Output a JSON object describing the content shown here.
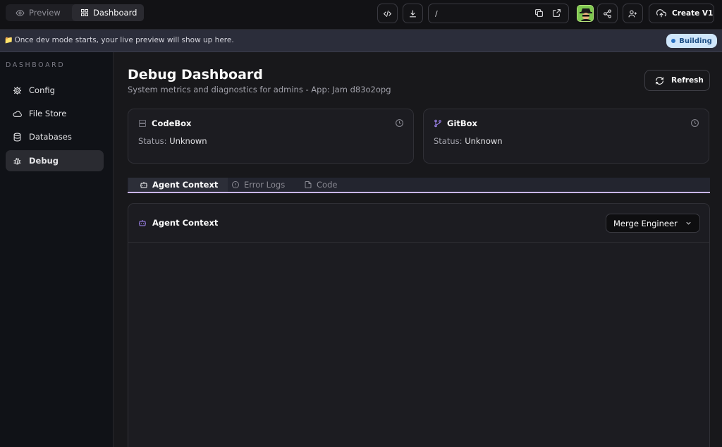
{
  "topbar": {
    "preview_label": "Preview",
    "dashboard_label": "Dashboard",
    "url_path": "/",
    "create_label": "Create V1"
  },
  "banner": {
    "emoji": "📁",
    "message": "Once dev mode starts, your live preview will show up here.",
    "status_badge": "Building"
  },
  "sidebar": {
    "title": "DASHBOARD",
    "items": [
      {
        "label": "Config",
        "icon": "settings-icon"
      },
      {
        "label": "File Store",
        "icon": "cloud-icon"
      },
      {
        "label": "Databases",
        "icon": "database-icon"
      },
      {
        "label": "Debug",
        "icon": "bug-icon",
        "active": true
      }
    ]
  },
  "main": {
    "title": "Debug Dashboard",
    "subtitle": "System metrics and diagnostics for admins - App: Jam d83o2opg",
    "refresh_label": "Refresh",
    "cards": [
      {
        "name": "CodeBox",
        "status_label": "Status:",
        "status_value": "Unknown",
        "icon": "server-icon"
      },
      {
        "name": "GitBox",
        "status_label": "Status:",
        "status_value": "Unknown",
        "icon": "git-branch-icon"
      }
    ],
    "tabs": [
      {
        "label": "Agent Context",
        "icon": "bot-icon",
        "active": true
      },
      {
        "label": "Error Logs",
        "icon": "alert-circle-icon"
      },
      {
        "label": "Code",
        "icon": "file-icon"
      }
    ],
    "panel": {
      "title": "Agent Context",
      "select_value": "Merge Engineer"
    }
  },
  "colors": {
    "accent": "#a78bfa",
    "badge_bg": "#cfe6fb",
    "badge_text": "#1d4f86"
  }
}
